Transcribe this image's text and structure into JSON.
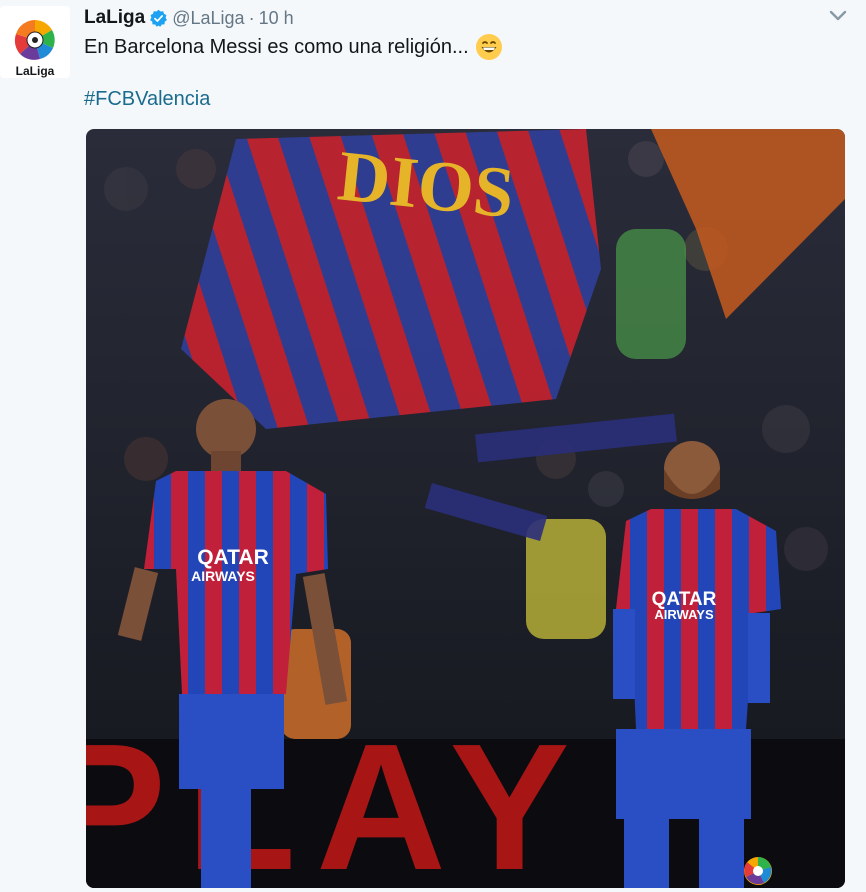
{
  "tweet": {
    "display_name": "LaLiga",
    "handle": "@LaLiga",
    "separator": "·",
    "time": "10 h",
    "text": "En Barcelona Messi es como una religión...",
    "hashtag": "#FCBValencia",
    "avatar_text": "LaLiga",
    "photo": {
      "banner_text": "DIOS",
      "sponsor_line1": "QATAR",
      "sponsor_line2": "AIRWAYS",
      "board_text": "PLAY"
    }
  },
  "colors": {
    "name": "#14171a",
    "meta": "#657786",
    "hashtag": "#1b6b8e",
    "verified": "#1da1f2",
    "background": "#f5f8fa"
  },
  "icons": [
    "verified-badge-icon",
    "chevron-down-icon",
    "grinning-emoji-icon",
    "laliga-logo-icon"
  ]
}
